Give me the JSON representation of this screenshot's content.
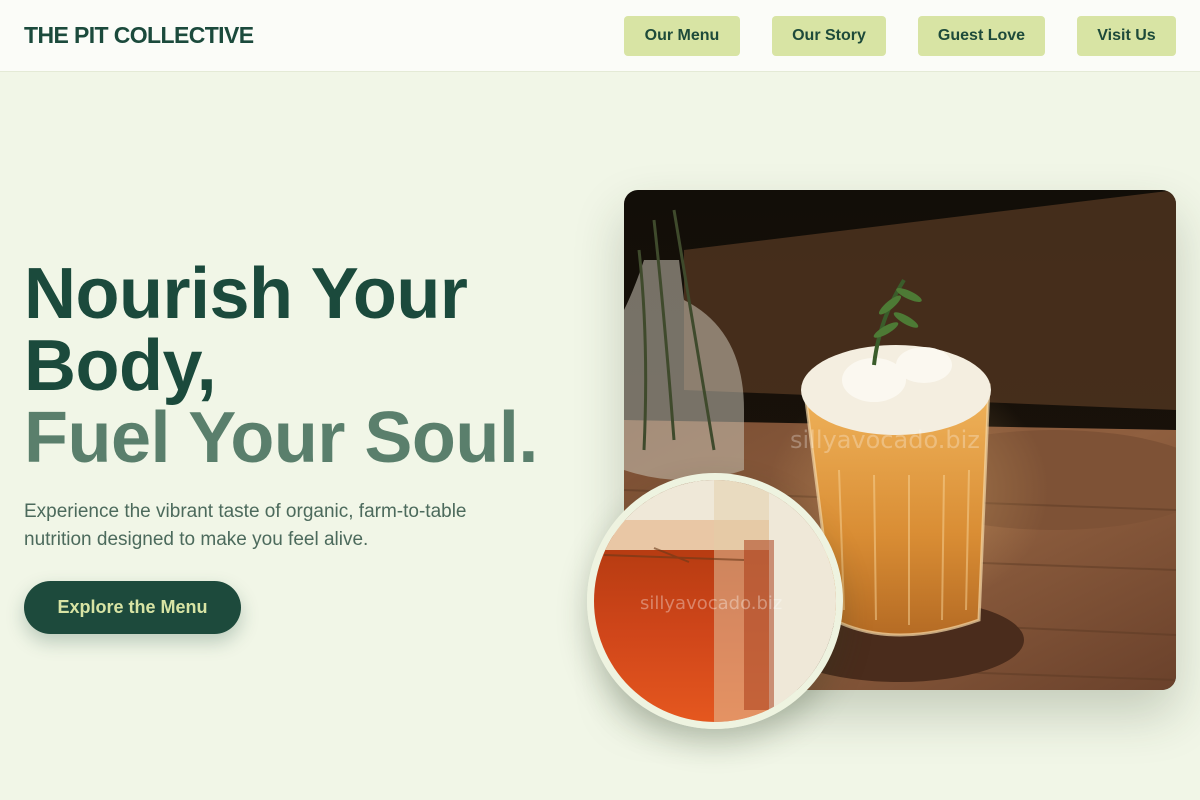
{
  "header": {
    "brand": "THE PIT COLLECTIVE",
    "nav": [
      "Our Menu",
      "Our Story",
      "Guest Love",
      "Visit Us"
    ]
  },
  "hero": {
    "title_line1": "Nourish Your",
    "title_line2": "Body,",
    "title_line3": "Fuel Your Soul.",
    "subtitle_line1": "Experience the vibrant taste of organic, farm-to-table",
    "subtitle_line2": "nutrition designed to make you feel alive.",
    "cta_label": "Explore the Menu"
  },
  "images": {
    "main": "iced-tea-drink-photo",
    "inset": "tea-glass-closeup-photo",
    "watermark": "sillyavocado.biz"
  },
  "colors": {
    "background": "#f1f6e7",
    "brand": "#1b4a3c",
    "accent_text": "#5a7f6c",
    "nav_button": "#d8e4a4",
    "cta_bg": "#1d4a3c",
    "cta_text": "#d8e4a4"
  }
}
